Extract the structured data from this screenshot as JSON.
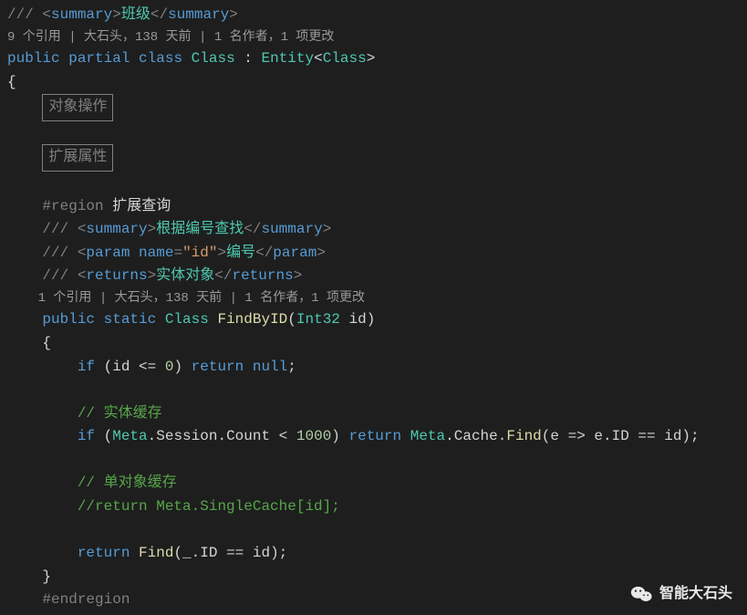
{
  "doc1": {
    "open": "/// <",
    "tag": "summary",
    "text": "班级",
    "close": ">"
  },
  "codelens1": "9 个引用 | 大石头，138 天前 | 1 名作者，1 项更改",
  "decl": {
    "public": "public",
    "partial": "partial",
    "class_kw": "class",
    "class_name": "Class",
    "colon": " : ",
    "base": "Entity",
    "lt": "<",
    "gt": ">",
    "generic": "Class"
  },
  "brace_open": "{",
  "collapsed1": "对象操作",
  "collapsed2": "扩展属性",
  "region_kw": "#region",
  "region_name": " 扩展查询",
  "doc2": {
    "open": "/// <",
    "tag": "summary",
    "text": "根据编号查找",
    "close": ">"
  },
  "doc3": {
    "open": "/// <",
    "tag": "param",
    "attr_name": "name",
    "attr_eq": "=",
    "attr_val": "\"id\"",
    "text": "编号",
    "close": ">"
  },
  "doc4": {
    "open": "/// <",
    "tag": "returns",
    "text": "实体对象",
    "close": ">"
  },
  "codelens2": "1 个引用 | 大石头，138 天前 | 1 名作者，1 项更改",
  "method_decl": {
    "public": "public",
    "static": "static",
    "ret": "Class",
    "name": "FindByID",
    "lp": "(",
    "param_type": "Int32",
    "param_name": " id",
    "rp": ")"
  },
  "brace2_open": "{",
  "if1": {
    "if": "if",
    "lp": " (",
    "var": "id",
    "op": " <= ",
    "num": "0",
    "rp": ") ",
    "return": "return",
    "null": " null",
    "semi": ";"
  },
  "comment1": "// 实体缓存",
  "if2": {
    "if": "if",
    "lp": " (",
    "meta": "Meta",
    "dot1": ".",
    "session": "Session",
    "dot2": ".",
    "count": "Count",
    "op": " < ",
    "num": "1000",
    "rp": ") ",
    "return": "return",
    "sp": " ",
    "meta2": "Meta",
    "dot3": ".",
    "cache": "Cache",
    "dot4": ".",
    "find": "Find",
    "lp2": "(",
    "e": "e",
    "arrow": " => ",
    "e2": "e",
    "dot5": ".",
    "id": "ID",
    "eq": " == ",
    "idvar": "id",
    "rp2": ");"
  },
  "comment2": "// 单对象缓存",
  "comment3": "//return Meta.SingleCache[id];",
  "ret": {
    "return": "return",
    "sp": " ",
    "find": "Find",
    "lp": "(",
    "under": "_",
    "dot": ".",
    "id": "ID",
    "eq": " == ",
    "idvar": "id",
    "rp": ");"
  },
  "brace2_close": "}",
  "endregion": "#endregion",
  "footer_text": "智能大石头"
}
